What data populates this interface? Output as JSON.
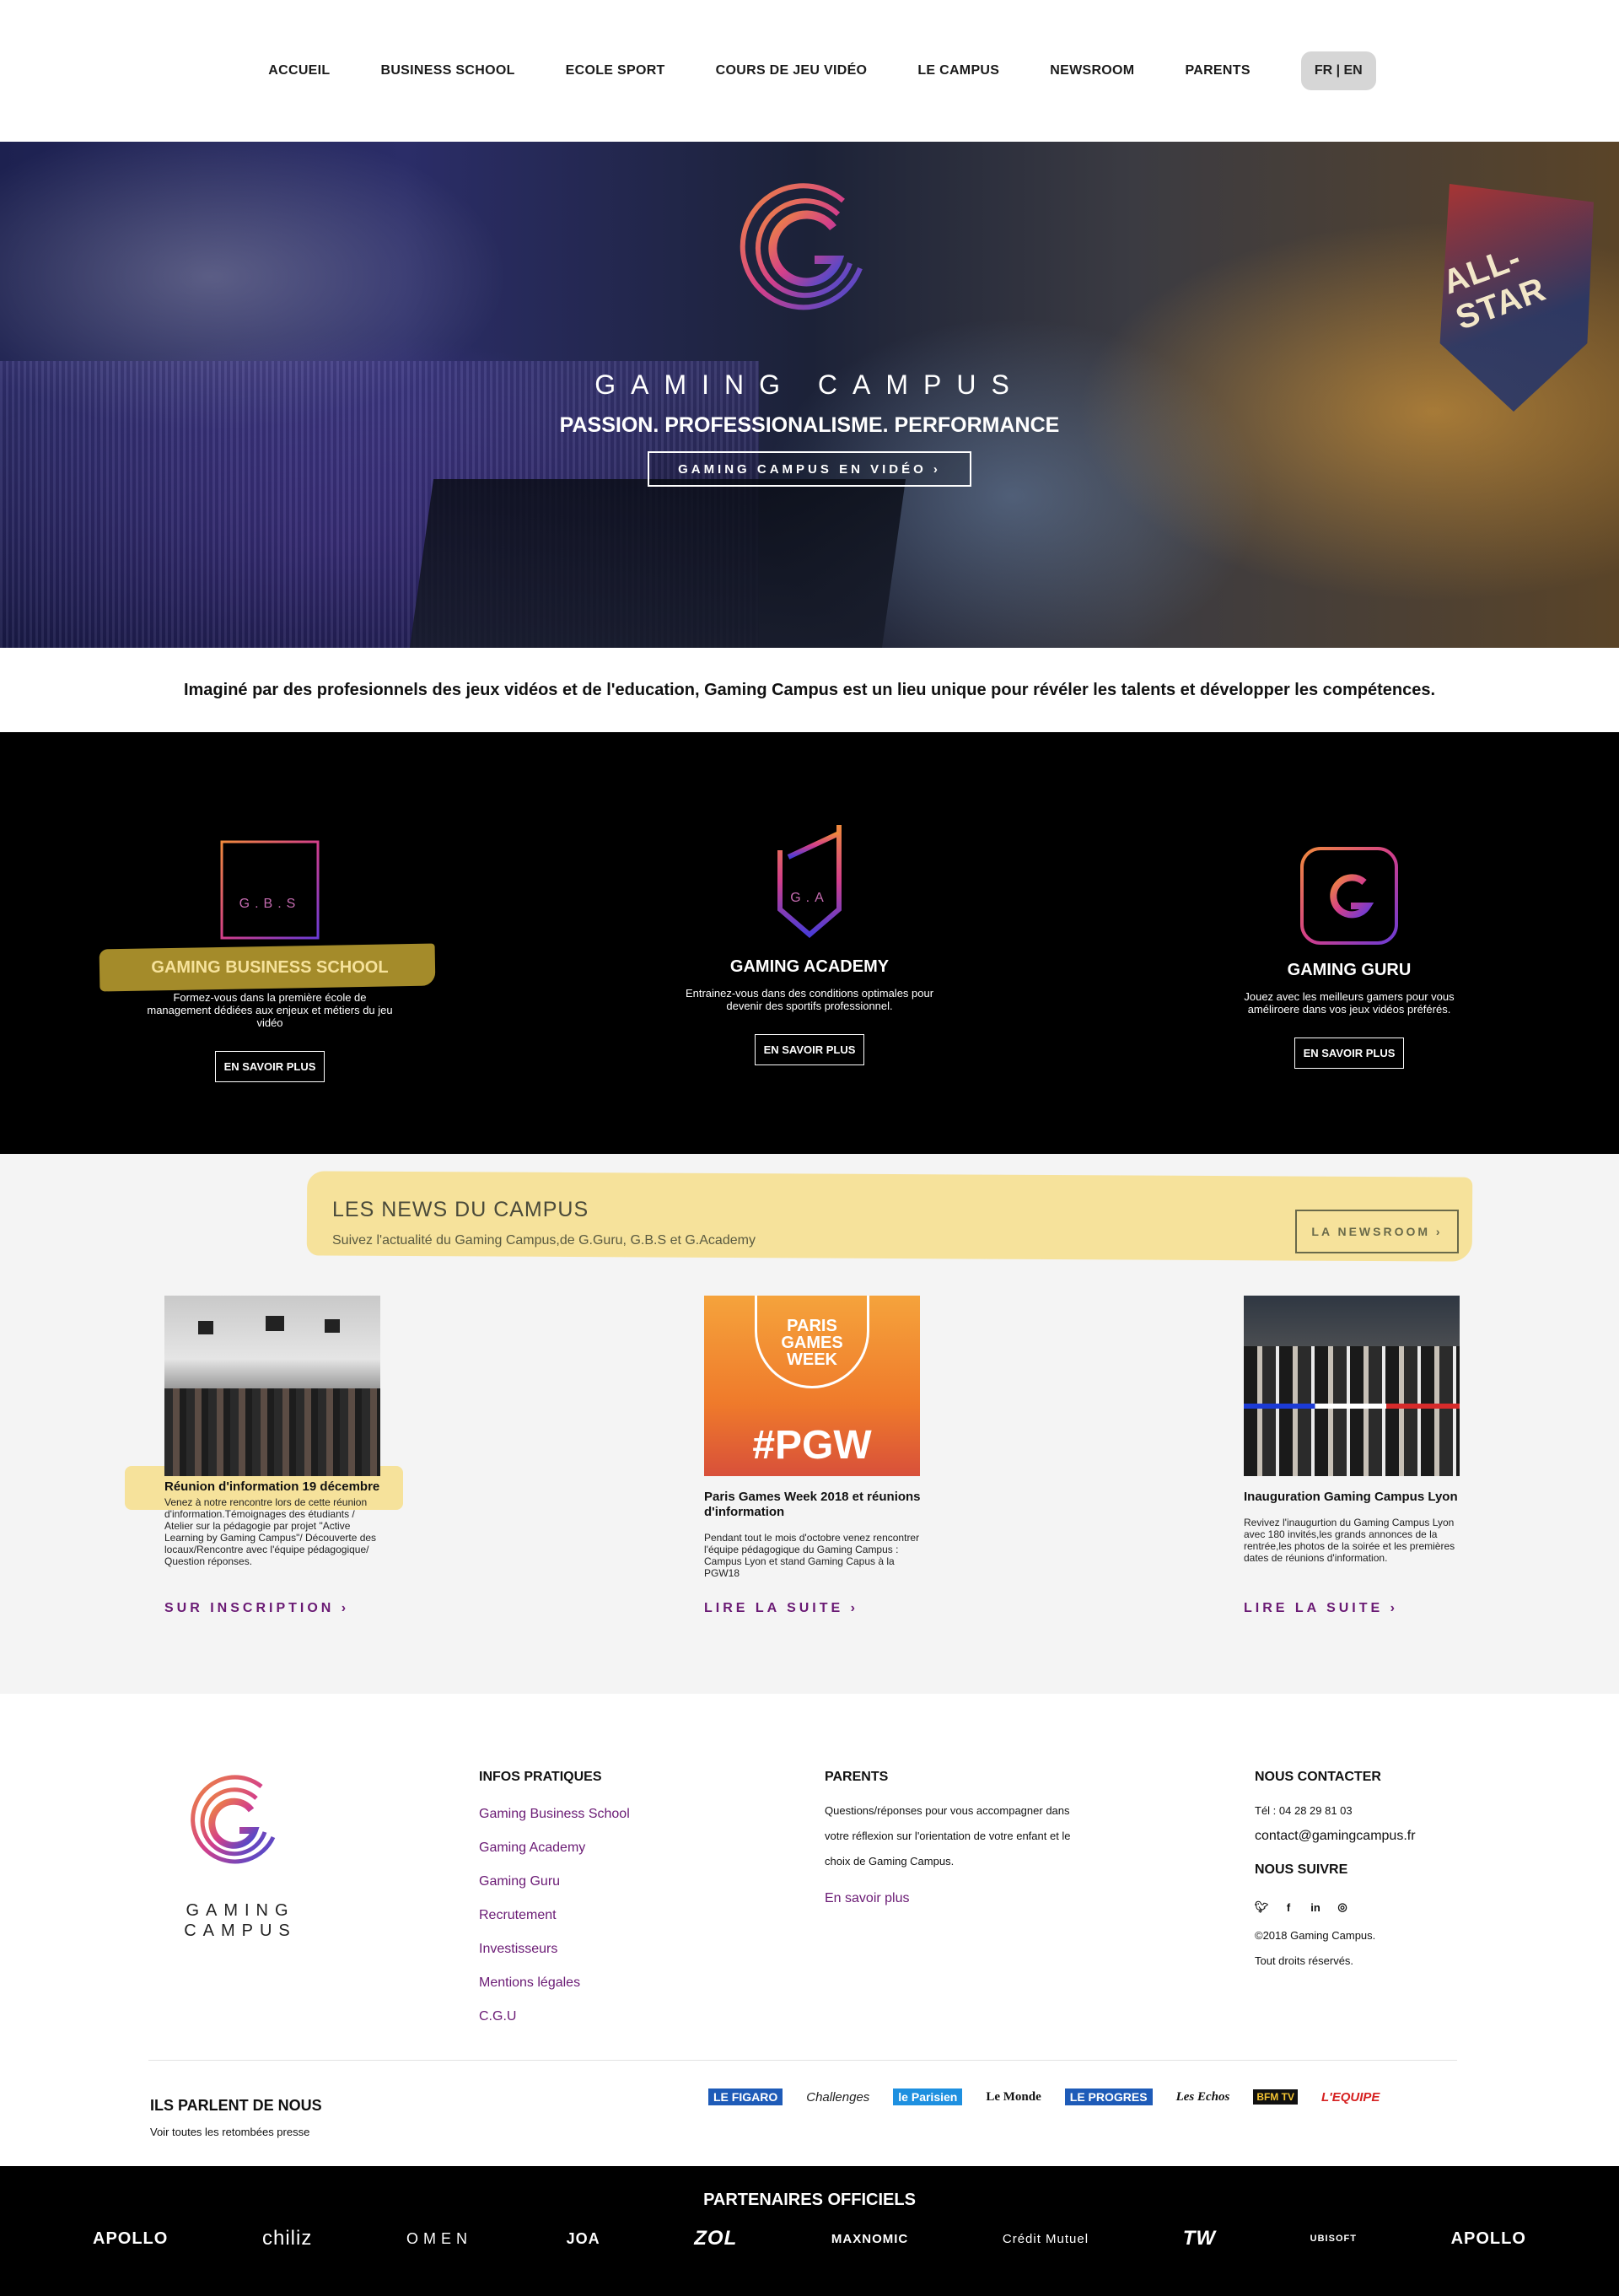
{
  "nav": {
    "items": [
      "ACCUEIL",
      "BUSINESS SCHOOL",
      "ECOLE SPORT",
      "COURS DE JEU VIDÉO",
      "LE CAMPUS",
      "NEWSROOM",
      "PARENTS"
    ],
    "lang": "FR | EN"
  },
  "hero": {
    "title": "GAMING CAMPUS",
    "tagline": "PASSION. PROFESSIONALISME. PERFORMANCE",
    "video_button": "GAMING CAMPUS EN VIDÉO ›",
    "badge_text": "ALL-STAR"
  },
  "intro": "Imaginé par des profesionnels des jeux vidéos et de l'education, Gaming Campus est un lieu unique pour révéler les talents et développer les compétences.",
  "schools": [
    {
      "logo_text": "G.B.S",
      "title": "GAMING BUSINESS SCHOOL",
      "desc": "Formez-vous dans la première école de management dédiées aux enjeux et métiers du jeu vidéo",
      "button": "EN SAVOIR PLUS"
    },
    {
      "logo_text": "G.A",
      "title": "GAMING ACADEMY",
      "desc": "Entrainez-vous dans des conditions optimales pour devenir des sportifs professionnel.",
      "button": "EN SAVOIR PLUS"
    },
    {
      "logo_text": "G",
      "title": "GAMING GURU",
      "desc": "Jouez avec les meilleurs gamers pour vous améliroere dans vos jeux vidéos préférés.",
      "button": "EN SAVOIR PLUS"
    }
  ],
  "news": {
    "title": "LES NEWS DU CAMPUS",
    "subtitle": "Suivez l'actualité du Gaming Campus,de G.Guru, G.B.S et G.Academy",
    "newsroom_button": "LA NEWSROOM ›",
    "cards": [
      {
        "title": "Réunion d'information 19 décembre",
        "desc": "Venez à notre rencontre lors de cette réunion d'information.Témoignages des étudiants / Atelier sur la pédagogie par projet \"Active Learning by Gaming Campus\"/ Découverte des locaux/Rencontre avec l'équipe pédagogique/ Question réponses.",
        "link": "SUR INSCRIPTION ›"
      },
      {
        "title": "Paris Games Week 2018 et réunions d'information",
        "desc": "Pendant tout le mois d'octobre venez rencontrer l'équipe pédagogique du Gaming Campus : Campus Lyon et stand Gaming Capus à la PGW18",
        "link": "LIRE LA SUITE ›",
        "img_title": "PARIS GAMES WEEK",
        "img_tag": "#PGW"
      },
      {
        "title": "Inauguration Gaming Campus Lyon",
        "desc": "Revivez l'inaugurtion du Gaming Campus Lyon avec 180 invités,les grands annonces de la rentrée,les photos de la soirée et les premières dates de réunions d'information.",
        "link": "LIRE LA SUITE ›"
      }
    ]
  },
  "footer": {
    "brand": "GAMING CAMPUS",
    "infos": {
      "heading": "INFOS PRATIQUES",
      "links": [
        "Gaming Business School",
        "Gaming Academy",
        "Gaming Guru",
        "Recrutement",
        "Investisseurs",
        "Mentions légales",
        "C.G.U"
      ]
    },
    "parents": {
      "heading": "PARENTS",
      "text": "Questions/réponses pour vous accompagner dans votre réflexion sur l'orientation de votre enfant et le choix de Gaming Campus.",
      "link": "En savoir plus"
    },
    "contact": {
      "heading": "NOUS CONTACTER",
      "phone": "Tél : 04 28 29 81 03",
      "email": "contact@gamingcampus.fr",
      "follow_heading": "NOUS SUIVRE",
      "social_icons": [
        "twitter-icon",
        "facebook-icon",
        "linkedin-icon",
        "instagram-icon"
      ],
      "copyright": "©2018 Gaming Campus.",
      "rights": "Tout droits réservés."
    },
    "press": {
      "heading": "ILS PARLENT DE NOUS",
      "link": "Voir toutes les retombées presse",
      "logos": [
        "LE FIGARO",
        "Challenges",
        "le Parisien",
        "Le Monde",
        "LE PROGRES",
        "Les Echos",
        "BFM TV",
        "L'EQUIPE"
      ]
    }
  },
  "partners": {
    "heading": "PARTENAIRES OFFICIELS",
    "logos": [
      "APOLLO",
      "chiliz",
      "OMEN",
      "JOA",
      "ZOL",
      "MAXNOMIC",
      "Crédit Mutuel",
      "TW",
      "UBISOFT",
      "APOLLO"
    ]
  },
  "colors": {
    "accent_purple": "#6a1a74",
    "highlight_yellow": "#f6e29b",
    "highlight_gold": "#a48b2a",
    "black": "#000000"
  }
}
